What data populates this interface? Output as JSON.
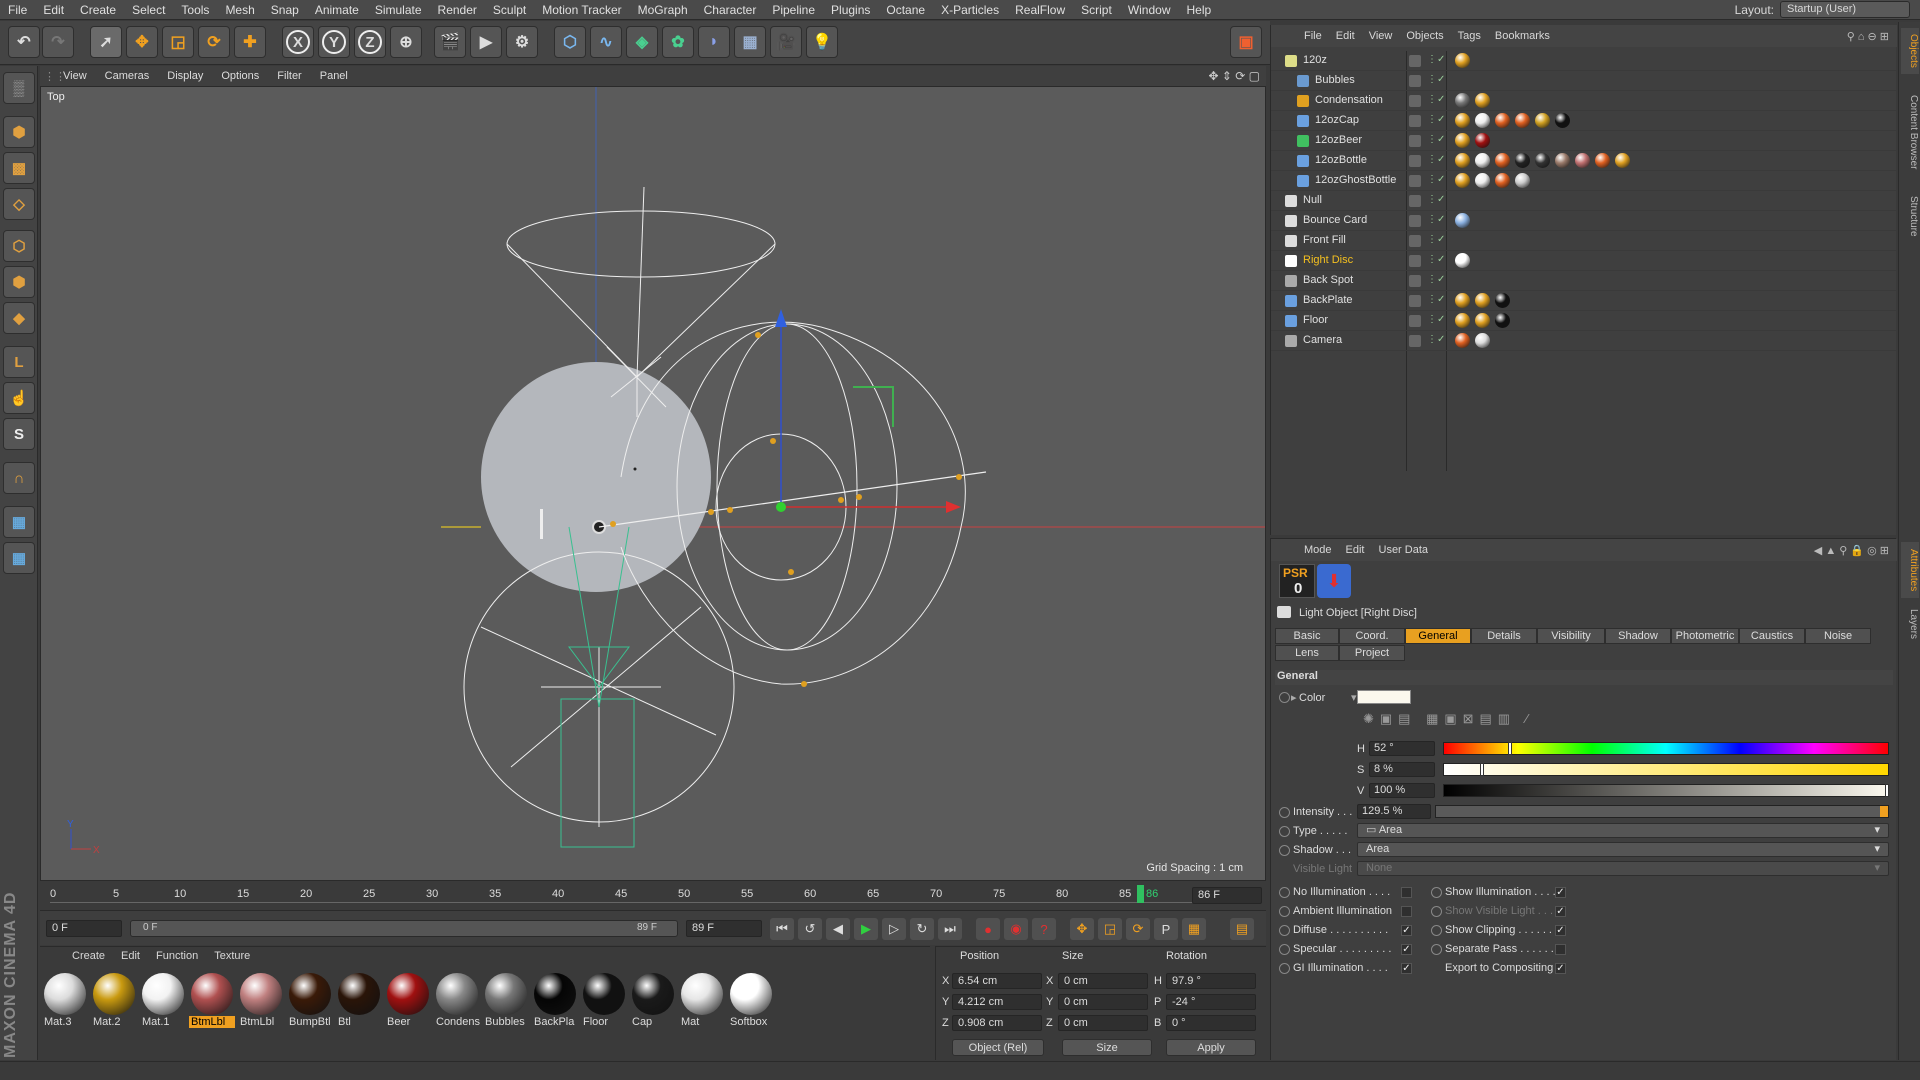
{
  "menubar": {
    "items": [
      "File",
      "Edit",
      "Create",
      "Select",
      "Tools",
      "Mesh",
      "Snap",
      "Animate",
      "Simulate",
      "Render",
      "Sculpt",
      "Motion Tracker",
      "MoGraph",
      "Character",
      "Pipeline",
      "Plugins",
      "Octane",
      "X-Particles",
      "RealFlow",
      "Script",
      "Window",
      "Help"
    ],
    "layout_label": "Layout:",
    "layout_value": "Startup (User)"
  },
  "toolbar": {
    "axis_x": "X",
    "axis_y": "Y",
    "axis_z": "Z"
  },
  "viewport": {
    "menu": [
      "View",
      "Cameras",
      "Display",
      "Options",
      "Filter",
      "Panel"
    ],
    "view_name": "Top",
    "grid_spacing": "Grid Spacing : 1 cm",
    "axis_y": "Y",
    "axis_x": "X"
  },
  "timeline": {
    "ticks": [
      "0",
      "5",
      "10",
      "15",
      "20",
      "25",
      "30",
      "35",
      "40",
      "45",
      "50",
      "55",
      "60",
      "65",
      "70",
      "75",
      "80",
      "85",
      "86"
    ],
    "current_frame": "86 F",
    "start_frame": "0 F",
    "range_start": "0 F",
    "range_end": "89 F",
    "end_frame": "89 F"
  },
  "materials": {
    "menu": [
      "Create",
      "Edit",
      "Function",
      "Texture"
    ],
    "items": [
      {
        "name": "Mat.3",
        "color": "#dcdcdc"
      },
      {
        "name": "Mat.2",
        "color": "#c99a10"
      },
      {
        "name": "Mat.1",
        "color": "#f2f2f2"
      },
      {
        "name": "BtmLbl",
        "color": "#b05050"
      },
      {
        "name": "BtmLbl",
        "color": "#c08080"
      },
      {
        "name": "BumpBtl",
        "color": "#3a1a08"
      },
      {
        "name": "Btl",
        "color": "#2a1408"
      },
      {
        "name": "Beer",
        "color": "#a01010"
      },
      {
        "name": "Condens",
        "color": "#888888"
      },
      {
        "name": "Bubbles",
        "color": "#777777"
      },
      {
        "name": "BackPla",
        "color": "#050505"
      },
      {
        "name": "Floor",
        "color": "#111111"
      },
      {
        "name": "Cap",
        "color": "#1a1a1a"
      },
      {
        "name": "Mat",
        "color": "#e6e6e6"
      },
      {
        "name": "Softbox",
        "color": "#ffffff"
      }
    ],
    "selected_index": 3
  },
  "coords": {
    "headers": {
      "position": "Position",
      "size": "Size",
      "rotation": "Rotation"
    },
    "rows": [
      {
        "label": "X",
        "pos": "6.54 cm",
        "size_label": "X",
        "size": "0 cm",
        "rot_label": "H",
        "rot": "97.9 °"
      },
      {
        "label": "Y",
        "pos": "4.212 cm",
        "size_label": "Y",
        "size": "0 cm",
        "rot_label": "P",
        "rot": "-24 °"
      },
      {
        "label": "Z",
        "pos": "0.908 cm",
        "size_label": "Z",
        "size": "0 cm",
        "rot_label": "B",
        "rot": "0 °"
      }
    ],
    "mode": "Object (Rel)",
    "size_mode": "Size",
    "apply": "Apply"
  },
  "objects": {
    "menu": [
      "File",
      "Edit",
      "View",
      "Objects",
      "Tags",
      "Bookmarks"
    ],
    "rows": [
      {
        "name": "120z",
        "indent": 0,
        "selected": false
      },
      {
        "name": "Bubbles",
        "indent": 1,
        "selected": false
      },
      {
        "name": "Condensation",
        "indent": 1,
        "selected": false
      },
      {
        "name": "12ozCap",
        "indent": 1,
        "selected": false
      },
      {
        "name": "12ozBeer",
        "indent": 1,
        "selected": false
      },
      {
        "name": "12ozBottle",
        "indent": 1,
        "selected": false
      },
      {
        "name": "12ozGhostBottle",
        "indent": 1,
        "selected": false
      },
      {
        "name": "Null",
        "indent": 0,
        "selected": false
      },
      {
        "name": "Bounce Card",
        "indent": 0,
        "selected": false
      },
      {
        "name": "Front Fill",
        "indent": 0,
        "selected": false
      },
      {
        "name": "Right Disc",
        "indent": 0,
        "selected": true
      },
      {
        "name": "Back Spot",
        "indent": 0,
        "selected": false
      },
      {
        "name": "BackPlate",
        "indent": 0,
        "selected": false
      },
      {
        "name": "Floor",
        "indent": 0,
        "selected": false
      },
      {
        "name": "Camera",
        "indent": 0,
        "selected": false
      }
    ]
  },
  "sidetabs": {
    "top": [
      "Objects",
      "Content Browser",
      "Structure"
    ],
    "bottom": [
      "Attributes",
      "Layers"
    ]
  },
  "attributes": {
    "menu": [
      "Mode",
      "Edit",
      "User Data"
    ],
    "psr": "PSR",
    "psr_value": "0",
    "title": "Light Object [Right Disc]",
    "tabs_row1": [
      "Basic",
      "Coord.",
      "General",
      "Details",
      "Visibility",
      "Shadow",
      "Photometric",
      "Caustics",
      "Noise"
    ],
    "tabs_row2": [
      "Lens",
      "Project"
    ],
    "active_tab": "General",
    "section": "General",
    "color_label": "Color",
    "h_label": "H",
    "h_value": "52 °",
    "h_fraction": 0.144,
    "s_label": "S",
    "s_value": "8 %",
    "s_fraction": 0.08,
    "v_label": "V",
    "v_value": "100 %",
    "v_fraction": 1.0,
    "intensity_label": "Intensity . . .",
    "intensity_value": "129.5 %",
    "type_label": "Type . . . . .",
    "type_value": "Area",
    "shadow_label": "Shadow . . .",
    "shadow_value": "Area",
    "visible_label": "Visible Light",
    "visible_value": "None",
    "checks_left": [
      {
        "label": "No Illumination . . . .",
        "checked": false
      },
      {
        "label": "Ambient Illumination",
        "checked": false
      },
      {
        "label": "Diffuse . . . . . . . . . .",
        "checked": true
      },
      {
        "label": "Specular . . . . . . . . .",
        "checked": true
      },
      {
        "label": "GI Illumination . . . .",
        "checked": true
      }
    ],
    "checks_right": [
      {
        "label": "Show Illumination . . . .",
        "checked": true,
        "dim": false
      },
      {
        "label": "Show Visible Light . . .",
        "checked": true,
        "dim": true
      },
      {
        "label": "Show Clipping . . . . . .",
        "checked": true,
        "dim": false
      },
      {
        "label": "Separate Pass . . . . . .",
        "checked": false,
        "dim": false
      },
      {
        "label": "Export to Compositing",
        "checked": true,
        "dim": false
      }
    ],
    "colors": {
      "accent": "#e8a020",
      "light_color": "#fbf8ee"
    }
  }
}
